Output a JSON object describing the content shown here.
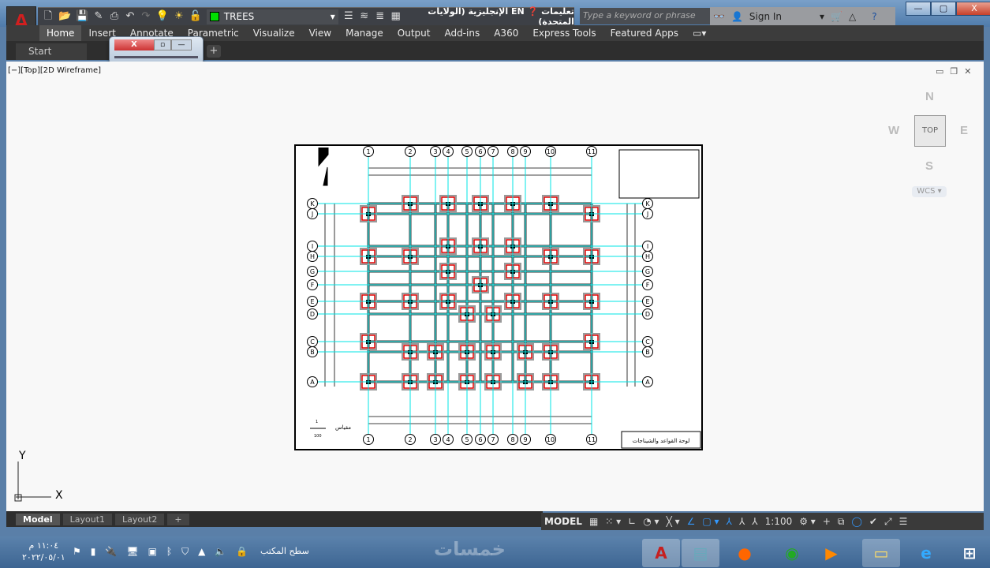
{
  "app": {
    "layer_name": "TREES",
    "layer_color": "#00e000",
    "language": "EN الإنجليزية (الولايات المتحدة)",
    "help_label": "تعليمات",
    "search_placeholder": "Type a keyword or phrase",
    "sign_in": "Sign In"
  },
  "window_buttons": {
    "minimize": "—",
    "maximize": "▢",
    "close": "X"
  },
  "ribbon": {
    "tabs": [
      "Home",
      "Insert",
      "Annotate",
      "Parametric",
      "Visualize",
      "View",
      "Manage",
      "Output",
      "Add-ins",
      "A360",
      "Express Tools",
      "Featured Apps"
    ],
    "active": "Home"
  },
  "doc_tabs": {
    "start": "Start",
    "new": "+"
  },
  "viewport": {
    "label": "[−][Top][2D Wireframe]",
    "viewcube": {
      "n": "N",
      "s": "S",
      "e": "E",
      "w": "W",
      "face": "TOP",
      "wcs": "WCS ▾"
    },
    "ucs": {
      "x": "X",
      "y": "Y"
    }
  },
  "drawing": {
    "columns": [
      "1",
      "2",
      "3",
      "4",
      "5",
      "6",
      "7",
      "8",
      "9",
      "10",
      "11"
    ],
    "rows": [
      "K",
      "J",
      "I",
      "H",
      "G",
      "F",
      "E",
      "D",
      "C",
      "B",
      "A"
    ],
    "title_block": "لوحة القواعد والشيناجات",
    "scale_label": "مقياس",
    "scale_num": "1",
    "scale_den": "100",
    "grid_color": "#00e5e5",
    "footing_color": "#e00000"
  },
  "layout_tabs": [
    "Model",
    "Layout1",
    "Layout2",
    "+"
  ],
  "status_bar": {
    "model": "MODEL",
    "scale": "1:100"
  },
  "taskbar": {
    "time": "١١:٠٤ م",
    "date": "٢٠٢٢/٠٥/٠١",
    "desktop": "سطح المكتب",
    "watermark": "خمسات"
  }
}
